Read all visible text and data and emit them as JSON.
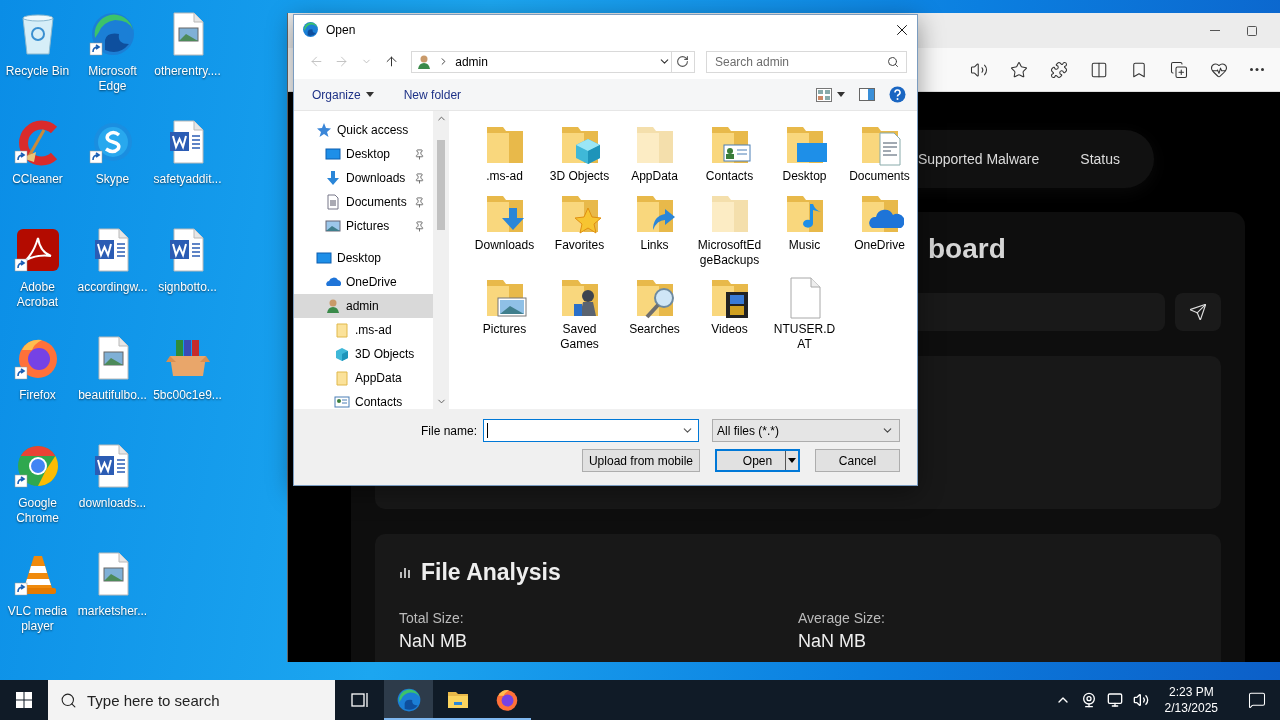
{
  "desktop": {
    "icons": [
      {
        "label": "Recycle Bin",
        "kind": "recycle-bin",
        "shortcut": false
      },
      {
        "label": "CCleaner",
        "kind": "ccleaner",
        "shortcut": true
      },
      {
        "label": "Adobe Acrobat",
        "kind": "acrobat",
        "shortcut": true
      },
      {
        "label": "Firefox",
        "kind": "firefox",
        "shortcut": true
      },
      {
        "label": "Google Chrome",
        "kind": "chrome",
        "shortcut": true
      },
      {
        "label": "VLC media player",
        "kind": "vlc",
        "shortcut": true
      },
      {
        "label": "Microsoft Edge",
        "kind": "edge",
        "shortcut": true
      },
      {
        "label": "Skype",
        "kind": "skype",
        "shortcut": true
      },
      {
        "label": "accordingw...",
        "kind": "word",
        "shortcut": false
      },
      {
        "label": "beautifulbo...",
        "kind": "image",
        "shortcut": false
      },
      {
        "label": "downloads...",
        "kind": "word",
        "shortcut": false
      },
      {
        "label": "marketsher...",
        "kind": "image",
        "shortcut": false
      },
      {
        "label": "otherentry....",
        "kind": "image",
        "shortcut": false
      },
      {
        "label": "safetyaddit...",
        "kind": "word",
        "shortcut": false
      },
      {
        "label": "signbotto...",
        "kind": "word",
        "shortcut": false
      },
      {
        "label": "5bc00c1e9...",
        "kind": "archive",
        "shortcut": false
      }
    ]
  },
  "browser": {
    "nav": [
      "Supported Malware",
      "Status"
    ],
    "heading": "board",
    "section_title": "File Analysis",
    "stats": [
      {
        "label": "Total Size:",
        "value": "NaN MB"
      },
      {
        "label": "Average Size:",
        "value": "NaN MB"
      }
    ]
  },
  "dialog": {
    "title": "Open",
    "path": "admin",
    "search": {
      "placeholder": "Search admin"
    },
    "commands": [
      "Organize",
      "New folder"
    ],
    "nav_pane": [
      {
        "label": "Quick access",
        "kind": "star",
        "selected": false,
        "children": [
          {
            "label": "Desktop",
            "kind": "desktop",
            "selected": false,
            "pinned": true
          },
          {
            "label": "Downloads",
            "kind": "downloads",
            "selected": false,
            "pinned": true
          },
          {
            "label": "Documents",
            "kind": "documents",
            "selected": false,
            "pinned": true
          },
          {
            "label": "Pictures",
            "kind": "pictures",
            "selected": false,
            "pinned": true
          }
        ]
      },
      {
        "label": "Desktop",
        "kind": "desktop",
        "selected": false,
        "children": [
          {
            "label": "OneDrive",
            "kind": "onedrive",
            "selected": false
          },
          {
            "label": "admin",
            "kind": "user",
            "selected": true,
            "children": [
              {
                "label": ".ms-ad",
                "kind": "folder",
                "selected": false
              },
              {
                "label": "3D Objects",
                "kind": "cube",
                "selected": false
              },
              {
                "label": "AppData",
                "kind": "folder",
                "selected": false
              },
              {
                "label": "Contacts",
                "kind": "contacts",
                "selected": false
              }
            ]
          }
        ]
      }
    ],
    "files": [
      {
        "label": ".ms-ad",
        "kind": "plain",
        "hidden": false
      },
      {
        "label": "3D Objects",
        "kind": "cube",
        "hidden": false
      },
      {
        "label": "AppData",
        "kind": "plain",
        "hidden": true
      },
      {
        "label": "Contacts",
        "kind": "contacts",
        "hidden": false
      },
      {
        "label": "Desktop",
        "kind": "desktop",
        "hidden": false
      },
      {
        "label": "Documents",
        "kind": "documents",
        "hidden": false
      },
      {
        "label": "Downloads",
        "kind": "downloads",
        "hidden": false
      },
      {
        "label": "Favorites",
        "kind": "favorites",
        "hidden": false
      },
      {
        "label": "Links",
        "kind": "links",
        "hidden": false
      },
      {
        "label": "MicrosoftEdgeBackups",
        "kind": "plain",
        "hidden": true
      },
      {
        "label": "Music",
        "kind": "music",
        "hidden": false
      },
      {
        "label": "OneDrive",
        "kind": "onedrive",
        "hidden": false
      },
      {
        "label": "Pictures",
        "kind": "pictures",
        "hidden": false
      },
      {
        "label": "Saved Games",
        "kind": "games",
        "hidden": false
      },
      {
        "label": "Searches",
        "kind": "searches",
        "hidden": false
      },
      {
        "label": "Videos",
        "kind": "videos",
        "hidden": false
      },
      {
        "label": "NTUSER.DAT",
        "kind": "file",
        "hidden": false
      }
    ],
    "file_name_label": "File name:",
    "file_type": "All files (*.*)",
    "buttons": [
      {
        "label": "Upload from mobile",
        "kind": "plain"
      },
      {
        "label": "Open",
        "kind": "split"
      },
      {
        "label": "Cancel",
        "kind": "plain"
      }
    ]
  },
  "taskbar": {
    "search": {
      "placeholder": "Type here to search"
    },
    "apps": [
      {
        "kind": "taskview",
        "selected": false,
        "running": false
      },
      {
        "kind": "edge",
        "selected": true,
        "running": true
      },
      {
        "kind": "explorer",
        "selected": false,
        "running": true
      },
      {
        "kind": "firefox",
        "selected": false,
        "running": true
      }
    ],
    "time": "2:23 PM",
    "date": "2/13/2025"
  }
}
